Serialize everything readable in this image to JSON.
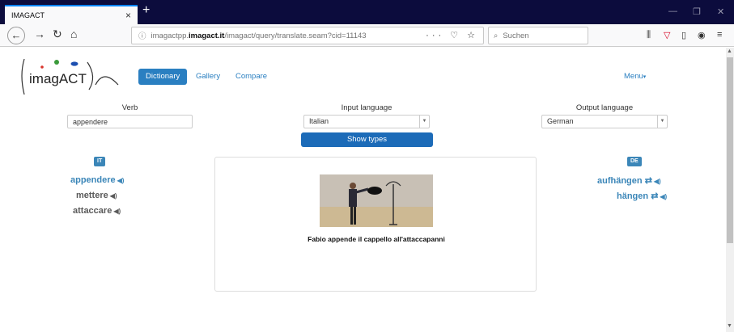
{
  "browser": {
    "tab_title": "IMAGACT",
    "tab_close": "×",
    "new_tab": "+",
    "url_prefix": "imagactpp.",
    "url_host": "imagact.it",
    "url_path": "/imagact/query/translate.seam?cid=11143",
    "url_actions": "··· ♡ ☆",
    "search_placeholder": "Suchen"
  },
  "logo": {
    "text": "imagACT"
  },
  "nav": {
    "items": [
      {
        "label": "Dictionary"
      },
      {
        "label": "Gallery"
      },
      {
        "label": "Compare"
      }
    ],
    "menu_label": "Menu"
  },
  "form": {
    "verb_label": "Verb",
    "verb_value": "appendere",
    "input_language_label": "Input language",
    "input_language_value": "Italian",
    "output_language_label": "Output language",
    "output_language_value": "German",
    "show_types_label": "Show types"
  },
  "source": {
    "badge": "IT",
    "verbs": [
      {
        "label": "appendere"
      },
      {
        "label": "mettere"
      },
      {
        "label": "attaccare"
      }
    ]
  },
  "target": {
    "badge": "DE",
    "verbs": [
      {
        "label": "aufhängen"
      },
      {
        "label": "hängen"
      }
    ]
  },
  "scene": {
    "caption": "Fabio appende il cappello all'attaccapanni"
  },
  "colors": {
    "accent": "#2a7fc1",
    "button": "#1c6bb8",
    "titlebar": "#0c0c3d"
  }
}
